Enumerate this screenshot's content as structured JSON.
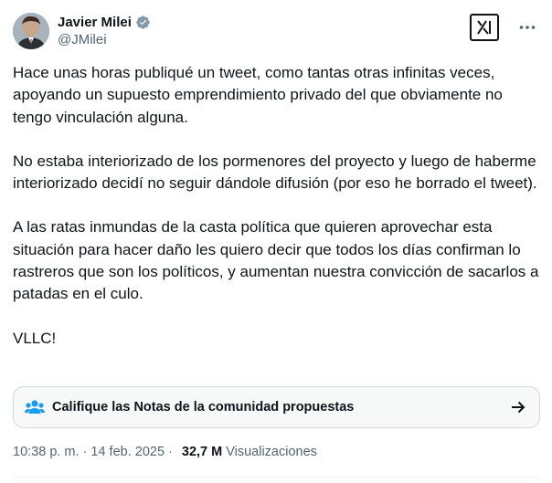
{
  "author": {
    "display_name": "Javier Milei",
    "handle": "@JMilei",
    "verified_icon": "verified-badge-icon",
    "verified_color": "#829aab"
  },
  "actions": {
    "grok_icon": "grok-icon",
    "more_icon": "more-options-icon"
  },
  "tweet": {
    "paragraphs": [
      "Hace unas horas publiqué un tweet, como tantas otras infinitas veces, apoyando un supuesto emprendimiento privado del que obviamente no tengo vinculación alguna.",
      "No estaba interiorizado de los pormenores del proyecto y luego de haberme interiorizado decidí no seguir dándole difusión (por eso he borrado el tweet).",
      "A las ratas inmundas de la casta política que quieren aprovechar esta situación para hacer daño les quiero decir que todos los días confirman lo rastreros que son los políticos, y aumentan nuestra convicción de sacarlos a patadas en el culo.",
      "VLLC!"
    ]
  },
  "community_notes": {
    "label": "Califique las Notas de la comunidad propuestas",
    "icon": "community-notes-icon",
    "accent_color": "#1d9bf0",
    "arrow_icon": "arrow-right-icon"
  },
  "meta": {
    "time": "10:38 p. m.",
    "separator": "·",
    "date": "14 feb. 2025",
    "views_count": "32,7 M",
    "views_label": "Visualizaciones"
  }
}
